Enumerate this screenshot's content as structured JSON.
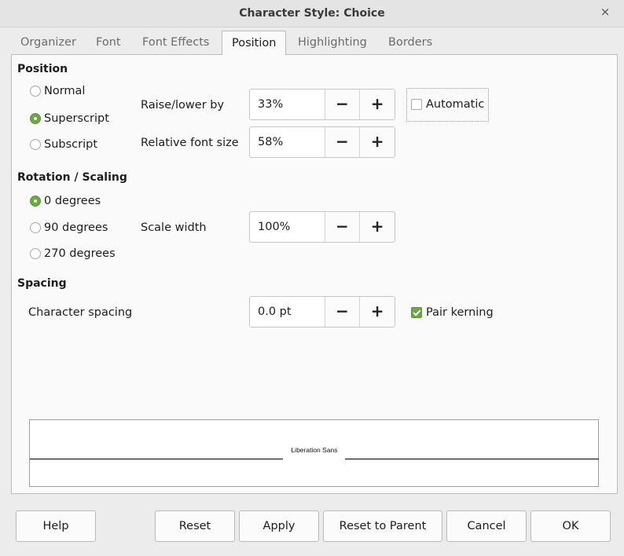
{
  "window": {
    "title": "Character Style: Choice",
    "close_glyph": "×"
  },
  "tabs": [
    {
      "label": "Organizer"
    },
    {
      "label": "Font"
    },
    {
      "label": "Font Effects"
    },
    {
      "label": "Position",
      "active": true
    },
    {
      "label": "Highlighting"
    },
    {
      "label": "Borders"
    }
  ],
  "position": {
    "title": "Position",
    "options": [
      {
        "label": "Normal",
        "checked": false
      },
      {
        "label": "Superscript",
        "checked": true
      },
      {
        "label": "Subscript",
        "checked": false
      }
    ],
    "raise_lower": {
      "label": "Raise/lower by",
      "value": "33%"
    },
    "relative_size": {
      "label": "Relative font size",
      "value": "58%"
    },
    "automatic": {
      "label": "Automatic",
      "checked": false
    }
  },
  "rotation": {
    "title": "Rotation / Scaling",
    "options": [
      {
        "label": "0 degrees",
        "checked": true
      },
      {
        "label": "90 degrees",
        "checked": false
      },
      {
        "label": "270 degrees",
        "checked": false
      }
    ],
    "scale_width": {
      "label": "Scale width",
      "value": "100%"
    }
  },
  "spacing": {
    "title": "Spacing",
    "char_spacing": {
      "label": "Character spacing",
      "value": "0.0 pt"
    },
    "pair_kerning": {
      "label": "Pair kerning",
      "checked": true
    }
  },
  "spin_buttons": {
    "minus": "−",
    "plus": "+"
  },
  "preview": {
    "sample_text": "Liberation Sans"
  },
  "buttons": {
    "help": "Help",
    "reset": "Reset",
    "apply": "Apply",
    "reset_parent": "Reset to Parent",
    "cancel": "Cancel",
    "ok": "OK"
  },
  "colors": {
    "accent": "#6da742",
    "panel_bg": "#fafafa",
    "window_bg": "#ececec"
  }
}
